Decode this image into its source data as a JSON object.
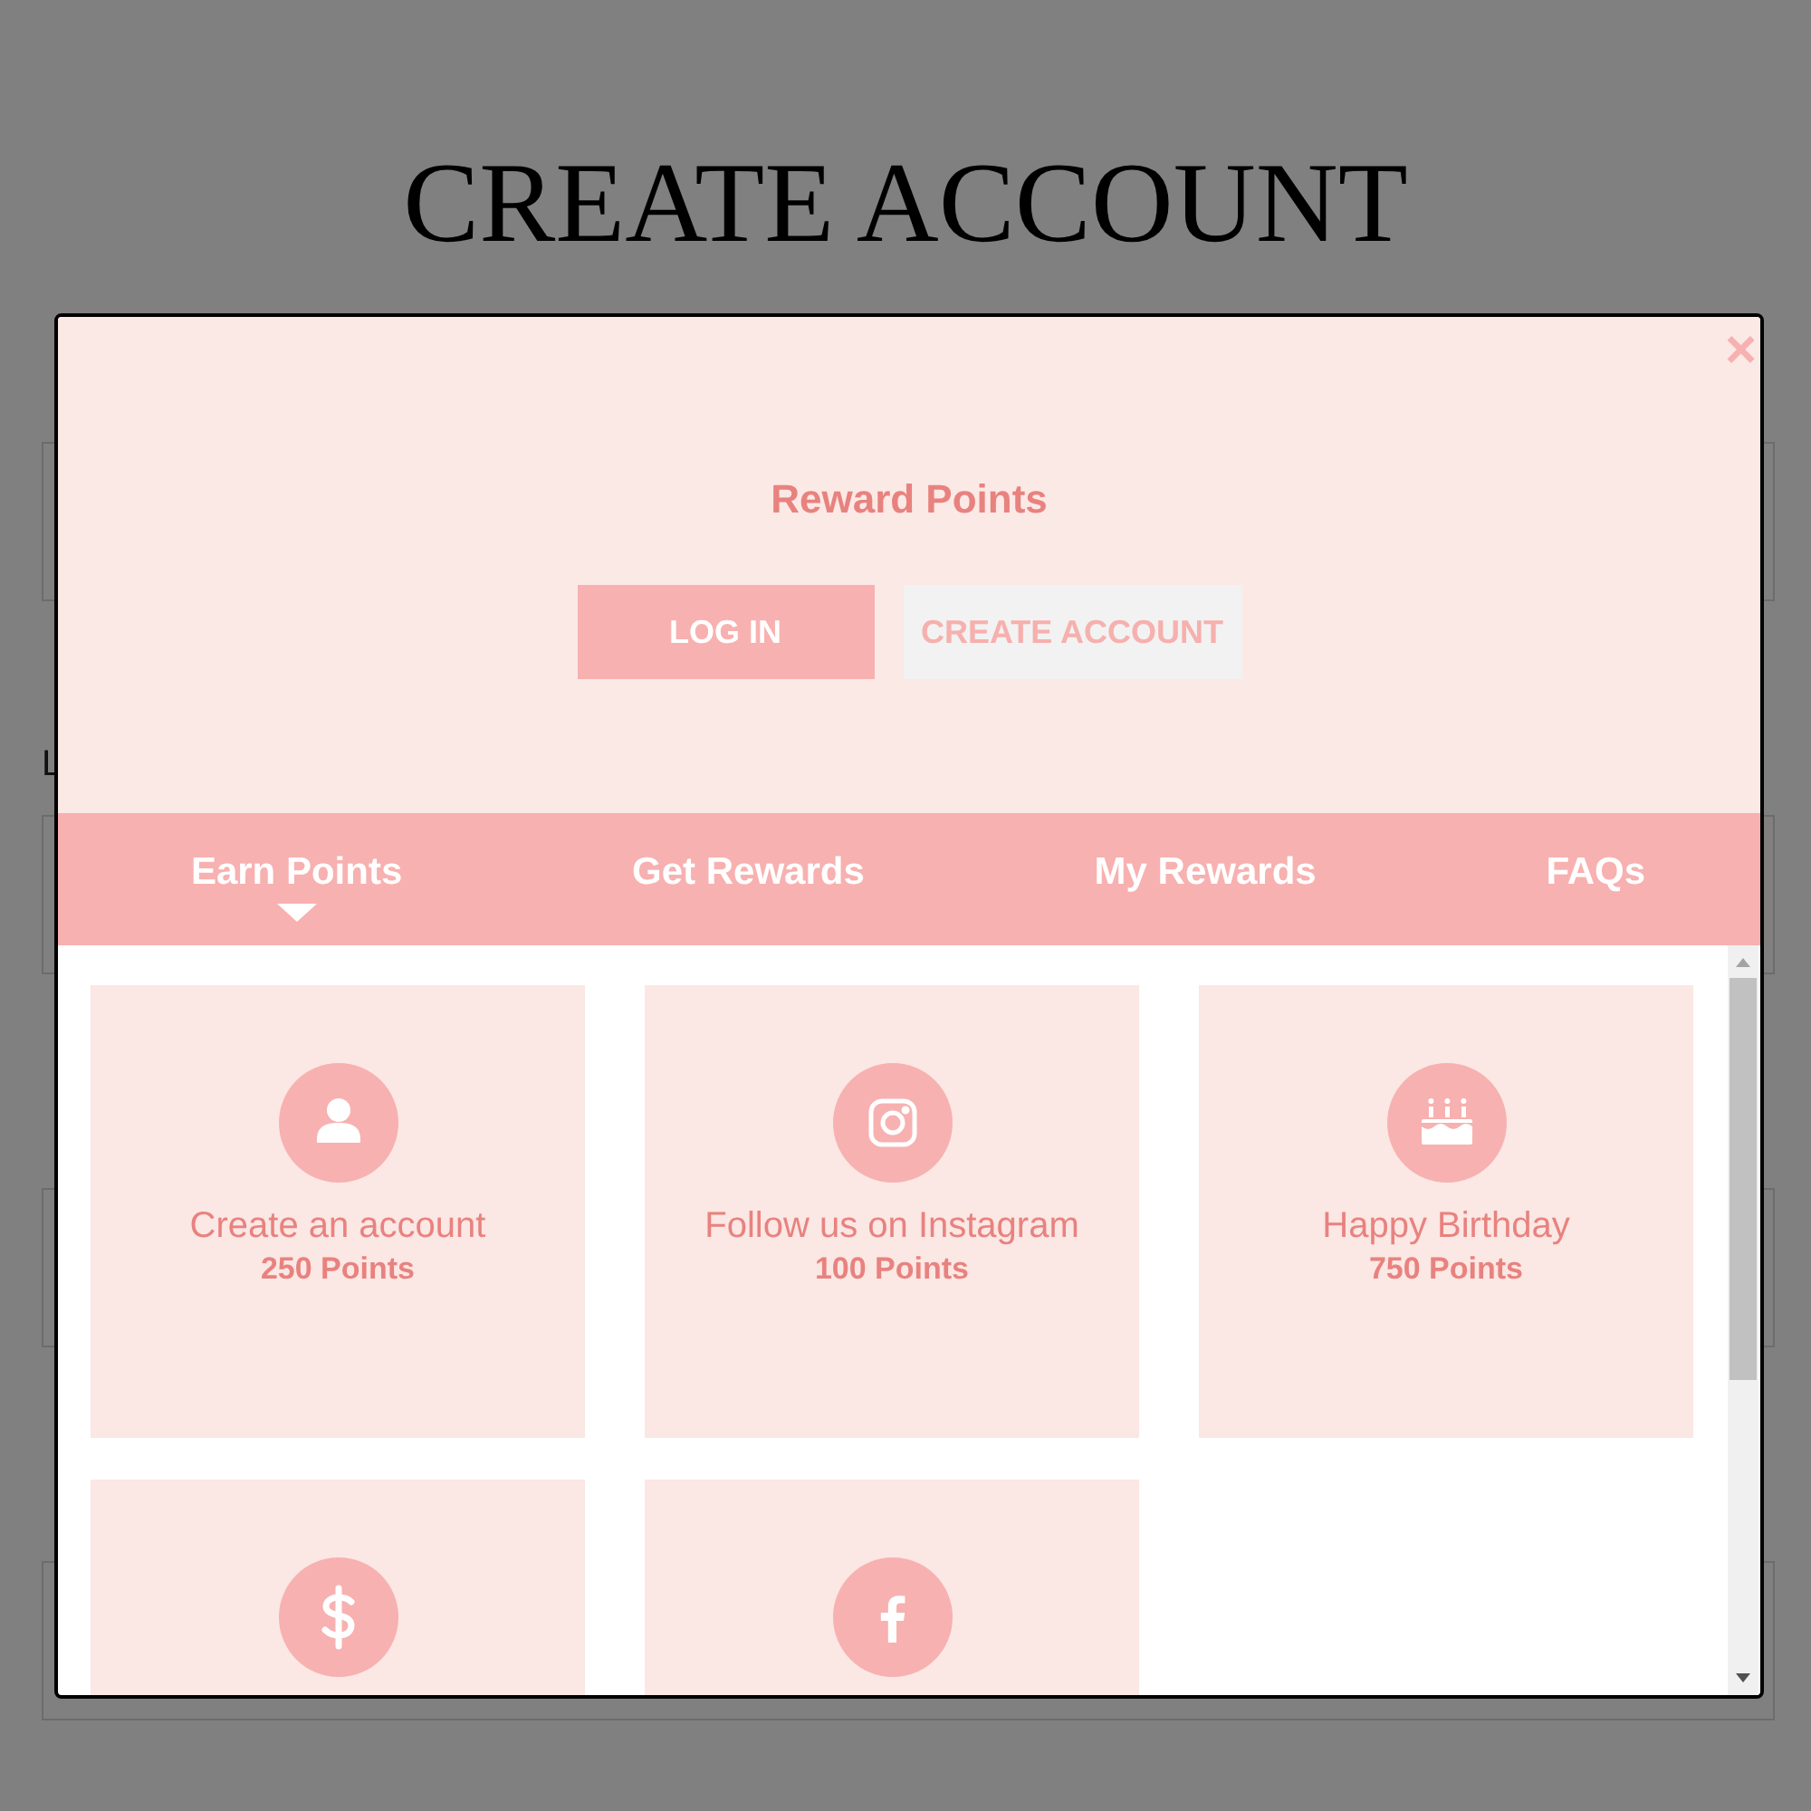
{
  "page": {
    "heading": "CREATE ACCOUNT",
    "field_label": "L"
  },
  "modal": {
    "close": "×",
    "title": "Reward Points",
    "buttons": [
      {
        "label": "LOG IN",
        "selected": true
      },
      {
        "label": "CREATE ACCOUNT",
        "selected": false
      }
    ],
    "tabs": [
      {
        "label": "Earn Points",
        "selected": true
      },
      {
        "label": "Get Rewards",
        "selected": false
      },
      {
        "label": "My Rewards",
        "selected": false
      },
      {
        "label": "FAQs",
        "selected": false
      }
    ],
    "cards": [
      {
        "kind": "account",
        "title": "Create an account",
        "points": "250 Points"
      },
      {
        "kind": "instagram",
        "title": "Follow us on Instagram",
        "points": "100 Points"
      },
      {
        "kind": "birthday",
        "title": "Happy Birthday",
        "points": "750 Points"
      },
      {
        "kind": "money"
      },
      {
        "kind": "facebook"
      }
    ]
  }
}
